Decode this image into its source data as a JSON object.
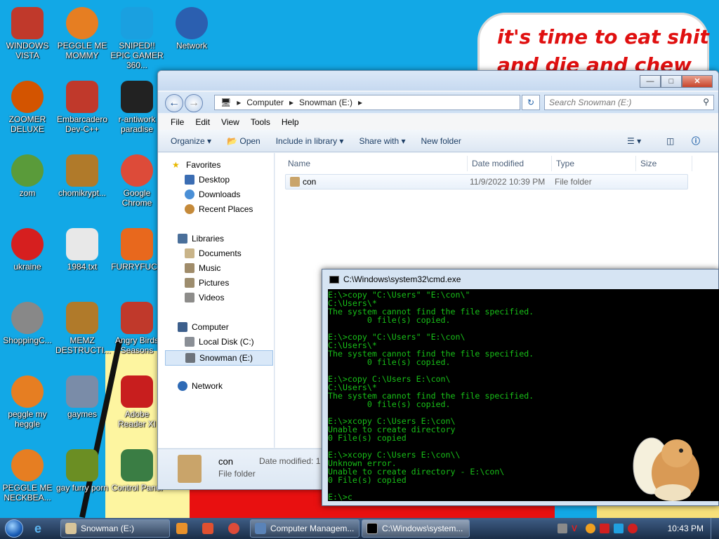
{
  "wallpaper": {
    "line1": "it's time to eat shit",
    "line2": "and die and chew"
  },
  "desktop_icons": [
    {
      "label": "WINDOWS VISTA",
      "color": "#c0392b"
    },
    {
      "label": "PEGGLE ME MOMMY",
      "color": "#e67e22"
    },
    {
      "label": "SNIPED!! EPIC GAMER 360...",
      "color": "#1aa0e0"
    },
    {
      "label": "Network",
      "color": "#2b5fb0"
    },
    {
      "label": "ZOOMER DELUXE",
      "color": "#d35400"
    },
    {
      "label": "Embarcadero Dev-C++",
      "color": "#c0392b"
    },
    {
      "label": "r-antiwork paradise",
      "color": "#222222"
    },
    {
      "label": "zom",
      "color": "#5a9b3a"
    },
    {
      "label": "chomikrypt...",
      "color": "#b07a2a"
    },
    {
      "label": "Google Chrome",
      "color": "#dd4b39"
    },
    {
      "label": "ukraine",
      "color": "#d61f1f"
    },
    {
      "label": "1984.txt",
      "color": "#e8e8e8"
    },
    {
      "label": "FURRYFUCK",
      "color": "#e8681d"
    },
    {
      "label": "ShoppingC...",
      "color": "#888888"
    },
    {
      "label": "MEMZ DESTRUCTI...",
      "color": "#b07a2a"
    },
    {
      "label": "Angry Birds Seasons",
      "color": "#c0392b"
    },
    {
      "label": "peggle my heggle",
      "color": "#e67e22"
    },
    {
      "label": "gaymes",
      "color": "#7a8ca8"
    },
    {
      "label": "Adobe Reader XI",
      "color": "#c81e1e"
    },
    {
      "label": "PEGGLE ME NECKBEA...",
      "color": "#e67e22"
    },
    {
      "label": "gay furry porn",
      "color": "#6b8e23"
    },
    {
      "label": "Control Panel",
      "color": "#3a7d44"
    }
  ],
  "explorer": {
    "breadcrumb": [
      "Computer",
      "Snowman (E:)"
    ],
    "search_placeholder": "Search Snowman (E:)",
    "menu": [
      "File",
      "Edit",
      "View",
      "Tools",
      "Help"
    ],
    "toolbar": [
      "Organize",
      "Open",
      "Include in library",
      "Share with",
      "New folder"
    ],
    "nav": {
      "favorites": "Favorites",
      "desktop": "Desktop",
      "downloads": "Downloads",
      "recent": "Recent Places",
      "libraries": "Libraries",
      "documents": "Documents",
      "music": "Music",
      "pictures": "Pictures",
      "videos": "Videos",
      "computer": "Computer",
      "local_disk": "Local Disk (C:)",
      "snowman": "Snowman (E:)",
      "network": "Network"
    },
    "columns": [
      "Name",
      "Date modified",
      "Type",
      "Size"
    ],
    "rows": [
      {
        "name": "con",
        "date": "11/9/2022 10:39 PM",
        "type": "File folder"
      }
    ],
    "details": {
      "name": "con",
      "type": "File folder",
      "date_label": "Date modified: 1"
    }
  },
  "cmd": {
    "title": "C:\\Windows\\system32\\cmd.exe",
    "output": "E:\\>copy \"C:\\Users\" \"E:\\con\\\"\nC:\\Users\\*\nThe system cannot find the file specified.\n        0 file(s) copied.\n\nE:\\>copy \"C:\\Users\" \"E:\\con\\\nC:\\Users\\*\nThe system cannot find the file specified.\n        0 file(s) copied.\n\nE:\\>copy C:\\Users E:\\con\\\nC:\\Users\\*\nThe system cannot find the file specified.\n        0 file(s) copied.\n\nE:\\>xcopy C:\\Users E:\\con\\\nUnable to create directory\n0 File(s) copied\n\nE:\\>xcopy C:\\Users E:\\con\\\\\nUnknown error.\nUnable to create directory - E:\\con\\\n0 File(s) copied\n\nE:\\>c"
  },
  "taskbar": {
    "tasks": [
      "Snowman (E:)",
      "Computer Managem...",
      "C:\\Windows\\system..."
    ],
    "clock": "10:43 PM"
  }
}
